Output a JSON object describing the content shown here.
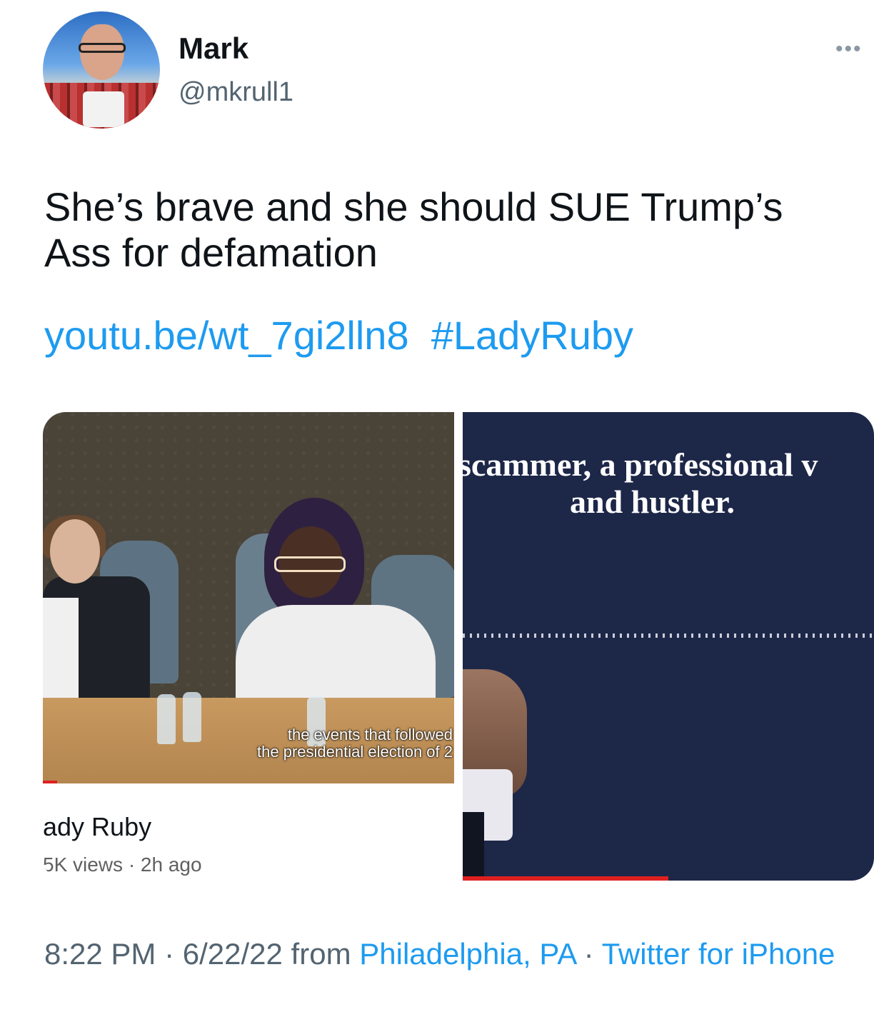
{
  "author": {
    "name": "Mark",
    "handle": "@mkrull1"
  },
  "more_icon": "•••",
  "tweet": {
    "text": "She’s brave and she should SUE Trump’s Ass for defamation",
    "link": "youtu.be/wt_7gi2lln8",
    "hashtag": "#LadyRuby"
  },
  "media": {
    "left": {
      "subtitle_line1": "the events that followed",
      "subtitle_line2": "the presidential election of 2",
      "video_title": "ady Ruby",
      "video_meta": "5K views · 2h ago"
    },
    "right": {
      "quote_line1": "scammer, a professional v",
      "quote_line2": "and hustler."
    }
  },
  "footer": {
    "time": "8:22 PM",
    "sep1": " · ",
    "date": "6/22/22",
    "from": " from ",
    "location": "Philadelphia, PA",
    "sep2": " · ",
    "source": "Twitter for iPhone"
  },
  "colors": {
    "link": "#1d9bf0",
    "secondary_text": "#536471",
    "progress": "#e02020"
  }
}
